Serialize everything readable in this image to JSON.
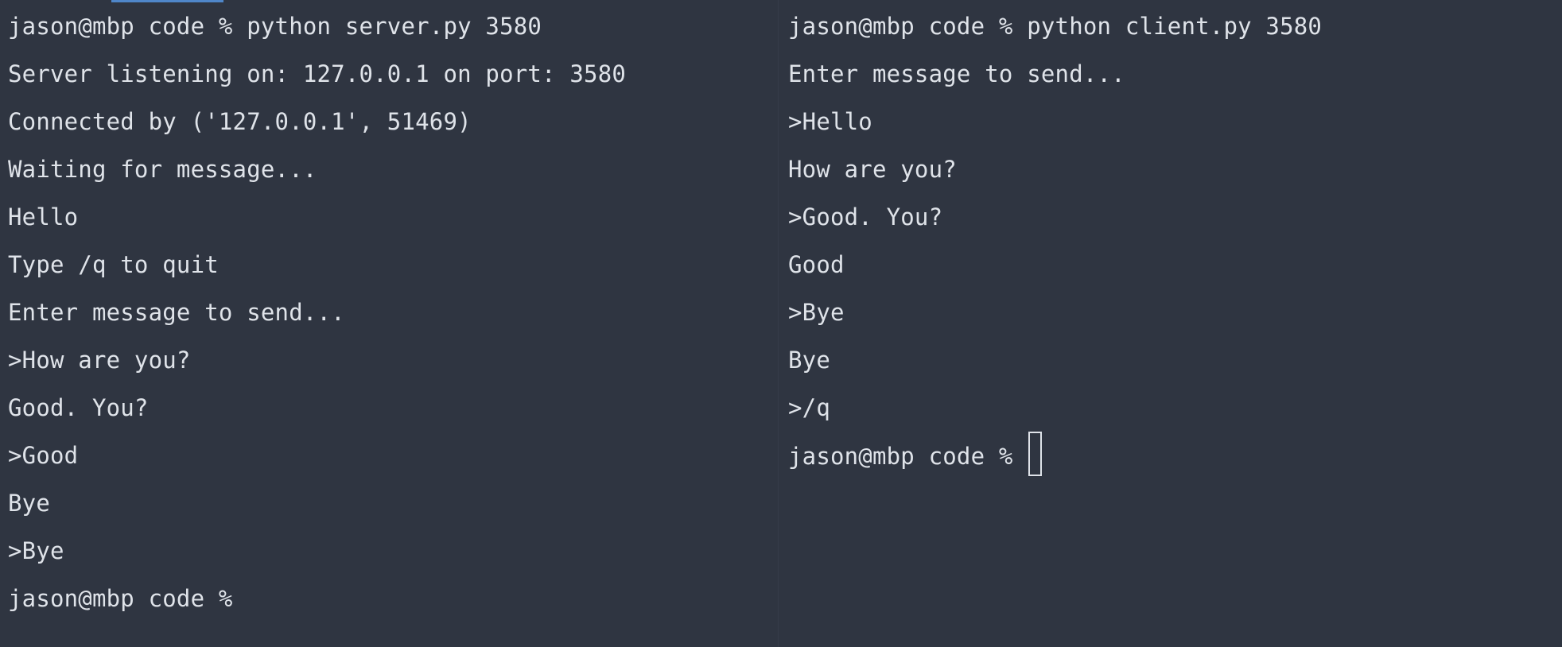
{
  "left_pane": {
    "lines": [
      "jason@mbp code % python server.py 3580",
      "Server listening on: 127.0.0.1 on port: 3580",
      "Connected by ('127.0.0.1', 51469)",
      "Waiting for message...",
      "Hello",
      "Type /q to quit",
      "Enter message to send...",
      ">How are you?",
      "Good. You?",
      ">Good",
      "Bye",
      ">Bye",
      "jason@mbp code %"
    ]
  },
  "right_pane": {
    "lines": [
      "jason@mbp code % python client.py 3580",
      "Enter message to send...",
      ">Hello",
      "How are you?",
      ">Good. You?",
      "Good",
      ">Bye",
      "Bye",
      ">/q"
    ],
    "prompt": "jason@mbp code % "
  }
}
